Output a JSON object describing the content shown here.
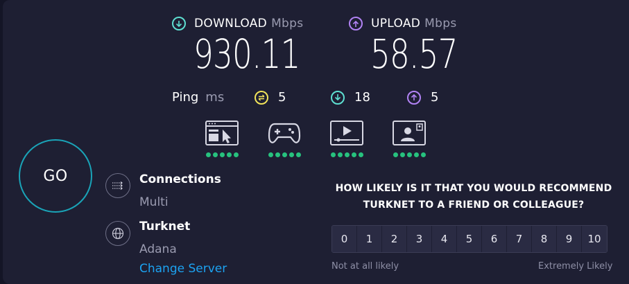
{
  "download": {
    "label": "DOWNLOAD",
    "unit": "Mbps",
    "value": "930.11",
    "icon": "arrow-down-circle-icon",
    "color": "#5ee0d2"
  },
  "upload": {
    "label": "UPLOAD",
    "unit": "Mbps",
    "value": "58.57",
    "icon": "arrow-up-circle-icon",
    "color": "#b283f5"
  },
  "ping": {
    "label": "Ping",
    "unit": "ms",
    "idle": {
      "value": "5",
      "color": "#f3e55a"
    },
    "download": {
      "value": "18",
      "color": "#5ee0d2"
    },
    "upload": {
      "value": "5",
      "color": "#b283f5"
    }
  },
  "app_ratings": [
    {
      "name": "web-browsing-icon",
      "rating": 5
    },
    {
      "name": "gaming-icon",
      "rating": 5
    },
    {
      "name": "video-streaming-icon",
      "rating": 5
    },
    {
      "name": "video-chat-icon",
      "rating": 5
    }
  ],
  "go_button": {
    "label": "GO"
  },
  "connections": {
    "title": "Connections",
    "value": "Multi"
  },
  "server": {
    "title": "Turknet",
    "location": "Adana",
    "change_label": "Change Server"
  },
  "survey": {
    "question_line1": "HOW LIKELY IS IT THAT YOU WOULD RECOMMEND",
    "question_line2": "TURKNET TO A FRIEND OR COLLEAGUE?",
    "options": [
      "0",
      "1",
      "2",
      "3",
      "4",
      "5",
      "6",
      "7",
      "8",
      "9",
      "10"
    ],
    "low_label": "Not at all likely",
    "high_label": "Extremely Likely"
  }
}
